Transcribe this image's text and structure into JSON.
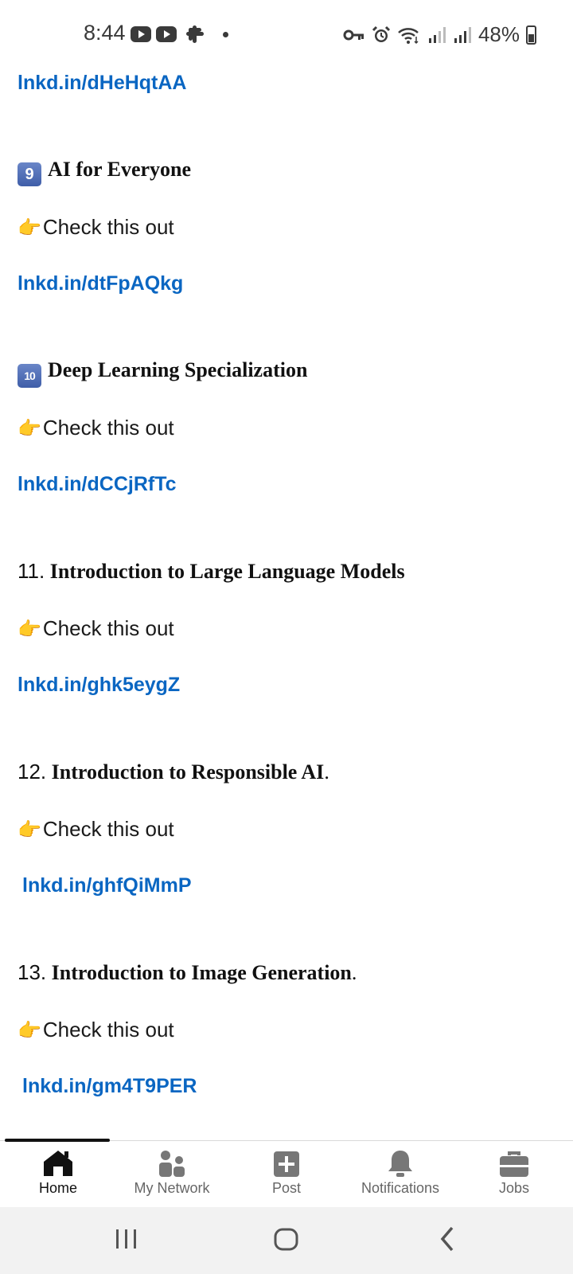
{
  "status": {
    "time": "8:44",
    "battery": "48%"
  },
  "post": {
    "top_link": "lnkd.in/dHeHqtAA",
    "items": [
      {
        "marker": "9",
        "title": "AI for Everyone",
        "suffix": "",
        "cta": "Check this out",
        "link": "lnkd.in/dtFpAQkg"
      },
      {
        "marker": "10",
        "title": "Deep Learning Specialization",
        "suffix": "",
        "cta": "Check this out",
        "link": "lnkd.in/dCCjRfTc"
      },
      {
        "marker": "11.",
        "title": "Introduction to Large Language Models",
        "suffix": "",
        "cta": "Check this out",
        "link": "lnkd.in/ghk5eygZ"
      },
      {
        "marker": "12.",
        "title": "Introduction to Responsible AI",
        "suffix": ".",
        "cta": "Check this out",
        "link": "lnkd.in/ghfQiMmP"
      },
      {
        "marker": "13.",
        "title": "Introduction to Image Generation",
        "suffix": ".",
        "cta": "Check this out",
        "link": "lnkd.in/gm4T9PER"
      }
    ]
  },
  "nav": {
    "home": "Home",
    "network": "My Network",
    "post": "Post",
    "notifications": "Notifications",
    "jobs": "Jobs"
  },
  "colors": {
    "link": "#0a66c2",
    "keycap": "#4a67b0"
  }
}
